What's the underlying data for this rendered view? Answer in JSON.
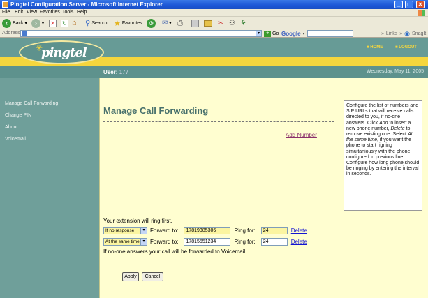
{
  "window": {
    "title": "Pingtel Configuration Server - Microsoft Internet Explorer"
  },
  "menu": [
    "File",
    "Edit",
    "View",
    "Favorites",
    "Tools",
    "Help"
  ],
  "toolbar": {
    "back": "Back",
    "search": "Search",
    "favorites": "Favorites"
  },
  "addressbar": {
    "label": "Address",
    "go": "Go",
    "google": "Google",
    "links": "Links",
    "snagit": "SnagIt"
  },
  "header": {
    "logo": "pingtel",
    "home": "HOME",
    "logout": "LOGOUT"
  },
  "userbar": {
    "label": "User:",
    "user_id": "177",
    "date": "Wednesday, May 11, 2005"
  },
  "sidebar": {
    "items": [
      {
        "label": "Manage Call Forwarding"
      },
      {
        "label": "Change PIN"
      },
      {
        "label": "About"
      },
      {
        "label": "Voicemail"
      }
    ]
  },
  "main": {
    "title": "Manage Call Forwarding",
    "add_number": "Add Number",
    "help": {
      "p1": "Configure the list of numbers and SIP URLs that will receive calls directed to you, if no-one answers. Click ",
      "add": "Add",
      "p2": " to insert a new phone number, ",
      "delete": "Delete",
      "p3": " to remove existing one. Select ",
      "same": "At the same time",
      "p4": ", if you want the phone to start rigning simultaniously with the phone configured in previous line. Configure how long phone should be ringing by entering the interval in seconds."
    },
    "ring_first": "Your extension will ring first.",
    "rows": [
      {
        "mode": "If no response",
        "forward_label": "Forward to:",
        "number": "17819385306",
        "ring_label": "Ring for:",
        "seconds": "24",
        "delete": "Delete"
      },
      {
        "mode": "At the same time",
        "forward_label": "Forward to:",
        "number": "17815551234",
        "ring_label": "Ring for:",
        "seconds": "24",
        "delete": "Delete"
      }
    ],
    "no_answer": "If no-one answers your call will be forwarded to Voicemail.",
    "apply": "Apply",
    "cancel": "Cancel"
  },
  "colors": {
    "accent_yellow": "#f5d63d",
    "teal": "#6f9f9a",
    "content_bg": "#fffed0",
    "title": "#47706c"
  }
}
